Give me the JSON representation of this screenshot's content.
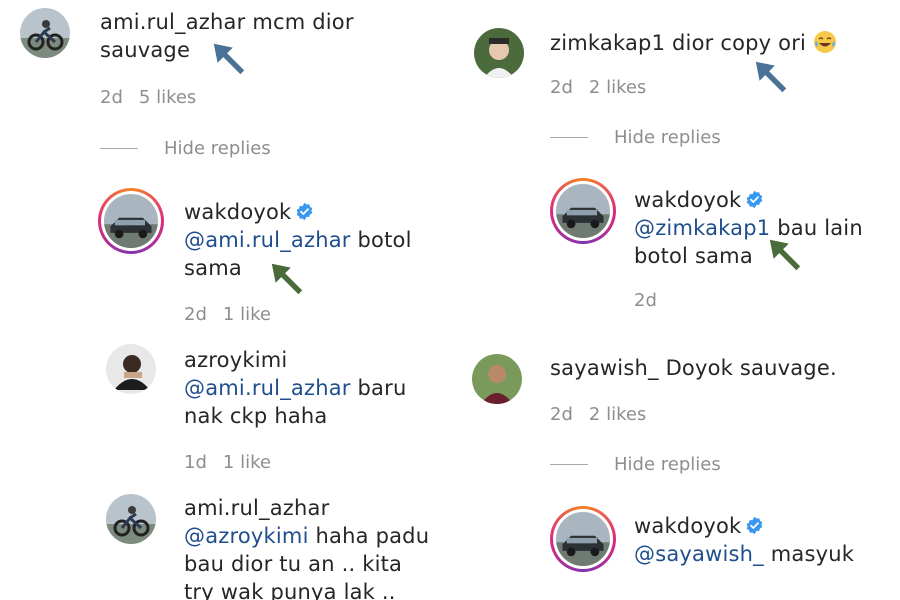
{
  "left": {
    "c1": {
      "username": "ami.rul_azhar",
      "text_line1": "mcm dior",
      "text_line2": "sauvage",
      "time": "2d",
      "likes": "5 likes"
    },
    "hide_replies": "Hide replies",
    "r1": {
      "username": "wakdoyok",
      "mention": "@ami.rul_azhar",
      "text_a": "botol",
      "text_b": "sama",
      "time": "2d",
      "likes": "1 like"
    },
    "r2": {
      "username": "azroykimi",
      "mention": "@ami.rul_azhar",
      "text_a": "baru",
      "text_b": "nak ckp haha",
      "time": "1d",
      "likes": "1 like"
    },
    "r3": {
      "username": "ami.rul_azhar",
      "mention": "@azroykimi",
      "text_a": "haha padu",
      "text_b": "bau dior tu an .. kita",
      "text_c": "try wak punya lak .."
    }
  },
  "right": {
    "c1": {
      "username": "zimkakap1",
      "text": "dior copy ori",
      "emoji": "crying-laughing-emoji",
      "time": "2d",
      "likes": "2 likes"
    },
    "hide_replies": "Hide replies",
    "r1": {
      "username": "wakdoyok",
      "mention": "@zimkakap1",
      "text_a": "bau lain",
      "text_b": "botol sama",
      "time": "2d"
    },
    "c2": {
      "username": "sayawish_",
      "text": "Doyok sauvage.",
      "time": "2d",
      "likes": "2 likes"
    },
    "hide_replies_2": "Hide replies",
    "r2": {
      "username": "wakdoyok",
      "mention": "@sayawish_",
      "text": "masyuk"
    }
  },
  "colors": {
    "mention": "#1f4e8c",
    "meta": "#8e8e8e",
    "verified": "#3897f0",
    "arrow_blue": "#4a7196",
    "arrow_green": "#4a6b3a"
  },
  "icons": {
    "verified": "verified-badge-icon",
    "arrow": "pointer-arrow-icon"
  }
}
